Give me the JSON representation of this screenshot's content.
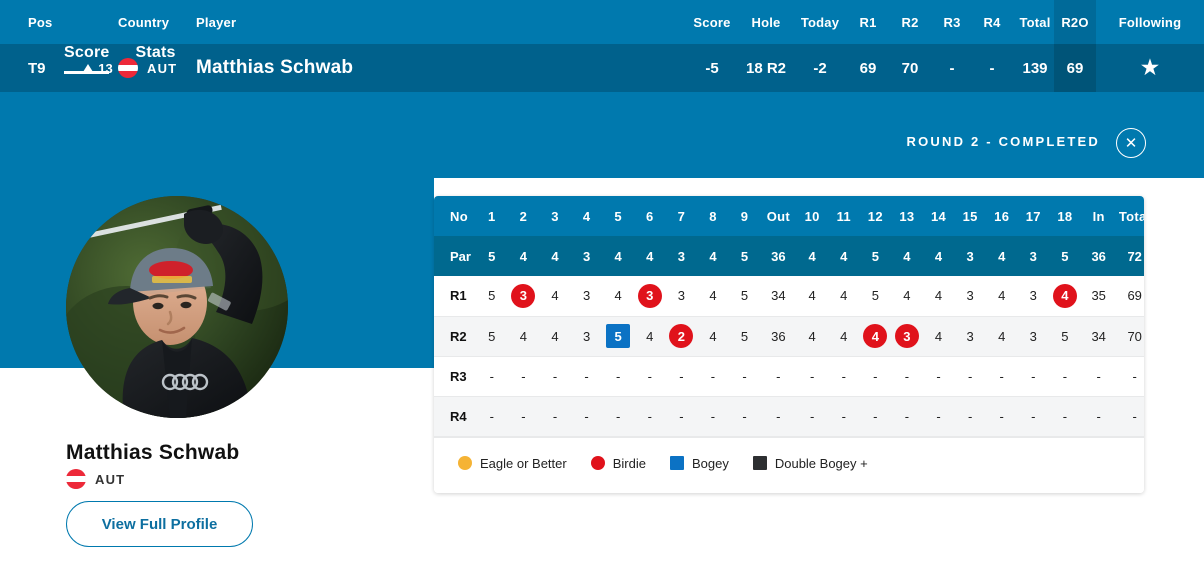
{
  "leaderboard": {
    "columns": {
      "pos": "Pos",
      "country": "Country",
      "player": "Player",
      "score": "Score",
      "hole": "Hole",
      "today": "Today",
      "r1": "R1",
      "r2": "R2",
      "r3": "R3",
      "r4": "R4",
      "total": "Total",
      "r2o": "R2O",
      "following": "Following"
    },
    "row": {
      "pos": "T9",
      "movement": "13",
      "movement_direction": "up",
      "country_code": "AUT",
      "player": "Matthias Schwab",
      "score": "-5",
      "hole": "18 R2",
      "today": "-2",
      "r1": "69",
      "r2": "70",
      "r3": "-",
      "r4": "-",
      "total": "139",
      "r2o": "69",
      "following_icon": "star-icon"
    }
  },
  "detail": {
    "tabs": [
      {
        "label": "Score",
        "active": true
      },
      {
        "label": "Stats",
        "active": false
      }
    ],
    "round_status": "ROUND 2 - COMPLETED",
    "close_icon": "close-icon",
    "player_name": "Matthias Schwab",
    "player_country": "AUT",
    "profile_button": "View Full Profile"
  },
  "scorecard": {
    "header": [
      "No",
      "1",
      "2",
      "3",
      "4",
      "5",
      "6",
      "7",
      "8",
      "9",
      "Out",
      "10",
      "11",
      "12",
      "13",
      "14",
      "15",
      "16",
      "17",
      "18",
      "In",
      "Total"
    ],
    "rows": [
      {
        "label": "Par",
        "type": "par",
        "front": [
          "5",
          "4",
          "4",
          "3",
          "4",
          "4",
          "3",
          "4",
          "5"
        ],
        "out": "36",
        "back": [
          "4",
          "4",
          "5",
          "4",
          "4",
          "3",
          "4",
          "3",
          "5"
        ],
        "in": "36",
        "total": "72"
      },
      {
        "label": "R1",
        "type": "round",
        "front": [
          "5",
          "3",
          "4",
          "3",
          "4",
          "3",
          "3",
          "4",
          "5"
        ],
        "front_marks": [
          "",
          "birdie",
          "",
          "",
          "",
          "birdie",
          "",
          "",
          ""
        ],
        "out": "34",
        "back": [
          "4",
          "4",
          "5",
          "4",
          "4",
          "3",
          "4",
          "3",
          "4"
        ],
        "back_marks": [
          "",
          "",
          "",
          "",
          "",
          "",
          "",
          "",
          "birdie"
        ],
        "in": "35",
        "total": "69"
      },
      {
        "label": "R2",
        "type": "round",
        "front": [
          "5",
          "4",
          "4",
          "3",
          "5",
          "4",
          "2",
          "4",
          "5"
        ],
        "front_marks": [
          "",
          "",
          "",
          "",
          "bogey",
          "",
          "birdie",
          "",
          ""
        ],
        "out": "36",
        "back": [
          "4",
          "4",
          "4",
          "3",
          "4",
          "3",
          "4",
          "3",
          "5"
        ],
        "back_marks": [
          "",
          "",
          "birdie",
          "birdie",
          "",
          "",
          "",
          "",
          ""
        ],
        "in": "34",
        "total": "70"
      },
      {
        "label": "R3",
        "type": "round",
        "front": [
          "-",
          "-",
          "-",
          "-",
          "-",
          "-",
          "-",
          "-",
          "-"
        ],
        "front_marks": [
          "",
          "",
          "",
          "",
          "",
          "",
          "",
          "",
          ""
        ],
        "out": "-",
        "back": [
          "-",
          "-",
          "-",
          "-",
          "-",
          "-",
          "-",
          "-",
          "-"
        ],
        "back_marks": [
          "",
          "",
          "",
          "",
          "",
          "",
          "",
          "",
          ""
        ],
        "in": "-",
        "total": "-"
      },
      {
        "label": "R4",
        "type": "round",
        "front": [
          "-",
          "-",
          "-",
          "-",
          "-",
          "-",
          "-",
          "-",
          "-"
        ],
        "front_marks": [
          "",
          "",
          "",
          "",
          "",
          "",
          "",
          "",
          ""
        ],
        "out": "-",
        "back": [
          "-",
          "-",
          "-",
          "-",
          "-",
          "-",
          "-",
          "-",
          "-"
        ],
        "back_marks": [
          "",
          "",
          "",
          "",
          "",
          "",
          "",
          "",
          ""
        ],
        "in": "-",
        "total": "-"
      }
    ],
    "legend": [
      {
        "label": "Eagle or Better",
        "shape": "circle",
        "color": "#f5b335"
      },
      {
        "label": "Birdie",
        "shape": "circle",
        "color": "#e0121b"
      },
      {
        "label": "Bogey",
        "shape": "square",
        "color": "#0b72c4"
      },
      {
        "label": "Double Bogey +",
        "shape": "square",
        "color": "#2d2f31"
      }
    ]
  },
  "colors": {
    "header_blue": "#0079ae",
    "row_blue": "#00618c",
    "par_blue": "#00698f",
    "birdie": "#e0121b",
    "bogey": "#0b72c4",
    "eagle": "#f5b335",
    "double_bogey": "#2d2f31"
  }
}
